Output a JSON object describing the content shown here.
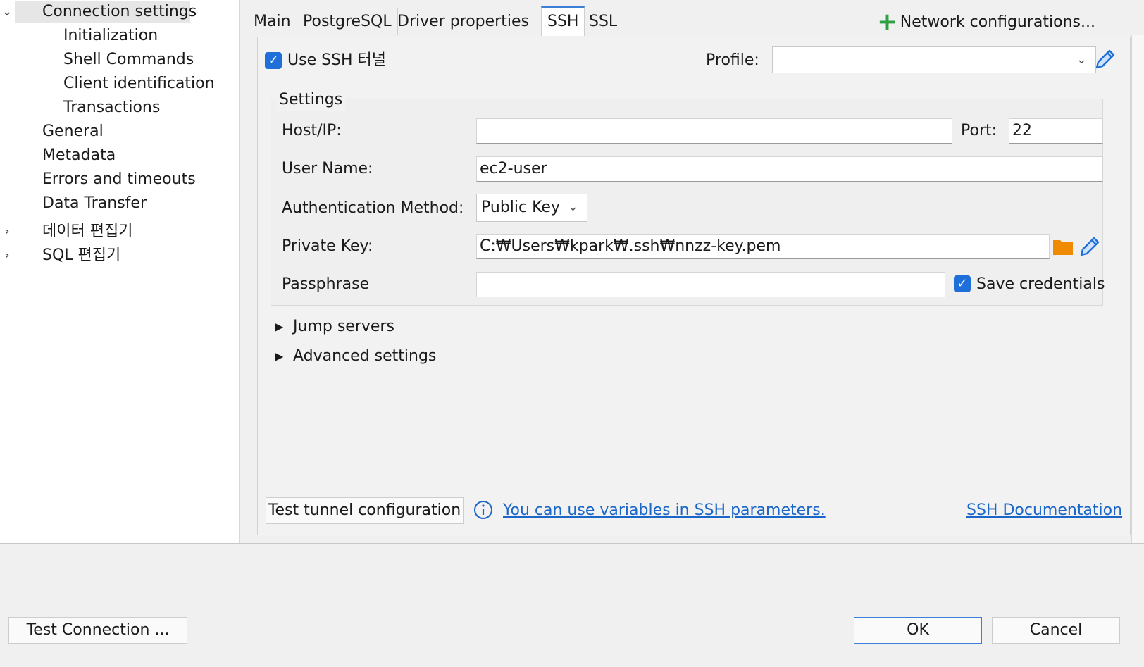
{
  "tree": {
    "items": [
      {
        "label": "Connection settings",
        "toggle": "⌄"
      },
      {
        "label": "Initialization"
      },
      {
        "label": "Shell Commands"
      },
      {
        "label": "Client identification"
      },
      {
        "label": "Transactions"
      },
      {
        "label": "General"
      },
      {
        "label": "Metadata"
      },
      {
        "label": "Errors and timeouts"
      },
      {
        "label": "Data Transfer"
      },
      {
        "label": "데이터 편집기",
        "toggle": "›"
      },
      {
        "label": "SQL 편집기",
        "toggle": "›"
      }
    ]
  },
  "tabs": [
    {
      "label": "Main"
    },
    {
      "label": "PostgreSQL"
    },
    {
      "label": "Driver properties"
    },
    {
      "label": "SSH"
    },
    {
      "label": "SSL"
    }
  ],
  "network_config_label": "Network configurations...",
  "ssh": {
    "use_ssh_label": "Use SSH 터널",
    "use_ssh_checked": true,
    "profile_label": "Profile:",
    "profile_value": "",
    "settings_title": "Settings",
    "host_label": "Host/IP:",
    "host_value": "",
    "port_label": "Port:",
    "port_value": "22",
    "user_label": "User Name:",
    "user_value": "ec2-user",
    "auth_label": "Authentication Method:",
    "auth_value": "Public Key",
    "private_key_label": "Private Key:",
    "private_key_value": "C:₩Users₩kpark₩.ssh₩nnzz-key.pem",
    "passphrase_label": "Passphrase",
    "passphrase_value": "",
    "save_credentials_label": "Save credentials",
    "save_credentials_checked": true,
    "jump_servers_label": "Jump servers",
    "advanced_label": "Advanced settings",
    "test_tunnel_label": "Test tunnel configuration",
    "variables_link": "You can use variables in SSH parameters.",
    "docs_link": "SSH Documentation"
  },
  "footer": {
    "test_connection_label": "Test Connection ...",
    "ok_label": "OK",
    "cancel_label": "Cancel"
  },
  "colors": {
    "accent": "#1e6fd9",
    "link": "#1a66c9",
    "folder": "#f08a00",
    "plus": "#2ea043"
  }
}
